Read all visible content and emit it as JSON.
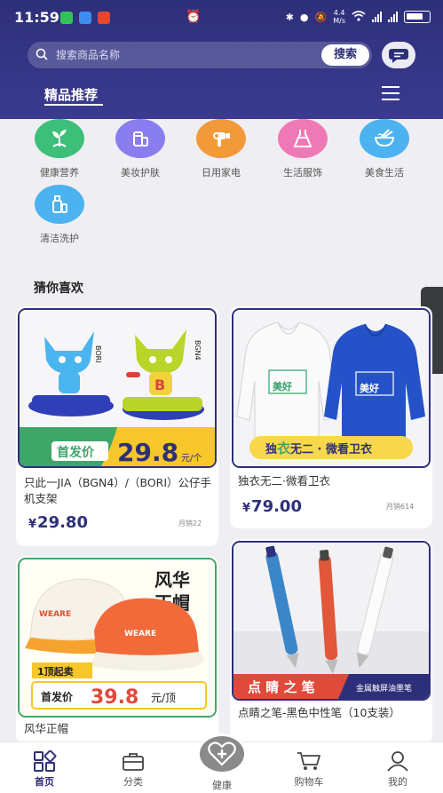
{
  "status_bar": {
    "time": "11:59",
    "network_speed": "4.4",
    "network_unit": "M/s"
  },
  "header": {
    "search_placeholder": "搜索商品名称",
    "search_button": "搜索",
    "tab_title": "精品推荐"
  },
  "categories": [
    {
      "label": "健康营养",
      "color": "#3dbf7a",
      "icon": "sprout-icon"
    },
    {
      "label": "美妆护肤",
      "color": "#8a7df0",
      "icon": "cosmetics-icon"
    },
    {
      "label": "日用家电",
      "color": "#f29a3a",
      "icon": "hair-dryer-icon"
    },
    {
      "label": "生活服饰",
      "color": "#ef79b6",
      "icon": "dress-icon"
    },
    {
      "label": "美食生活",
      "color": "#4cb2f0",
      "icon": "noodle-bowl-icon"
    },
    {
      "label": "清洁洗护",
      "color": "#4cb2f0",
      "icon": "cleaning-bottle-icon"
    }
  ],
  "section_title": "猜你喜欢",
  "products": [
    {
      "title": "只此一JIA（BGN4）/（BORI）公仔手机支架",
      "price_symbol": "¥",
      "price": "29.80",
      "sales": "月销22",
      "banner_left": "首发价",
      "banner_price": "29.8",
      "banner_unit": "元/个",
      "figure_left_label": "BORI",
      "figure_right_label": "BGN4"
    },
    {
      "title": "独衣无二·微看卫衣",
      "price_symbol": "¥",
      "price": "79.00",
      "sales": "月销614",
      "banner_text_1": "独",
      "banner_text_2": "衣",
      "banner_text_3": "无二 · 微看卫衣",
      "hoodie_print": "美好"
    },
    {
      "title": "风华正帽",
      "banner_title_1": "风华",
      "banner_title_2": "正帽",
      "min_order": "1顶起卖",
      "banner_left": "首发价",
      "banner_price": "39.8",
      "banner_unit": "元/顶",
      "cap_brand": "WEARE"
    },
    {
      "title": "点睛之笔-黑色中性笔（10支装）",
      "banner_text": "点 睛 之 笔",
      "banner_sub": "金属触屏油墨笔"
    }
  ],
  "tabbar": [
    {
      "label": "首页",
      "icon": "home-grid-icon",
      "active": true
    },
    {
      "label": "分类",
      "icon": "category-bag-icon",
      "active": false
    },
    {
      "label": "健康",
      "icon": "health-heart-icon",
      "active": false
    },
    {
      "label": "购物车",
      "icon": "cart-icon",
      "active": false
    },
    {
      "label": "我的",
      "icon": "user-icon",
      "active": false
    }
  ],
  "colors": {
    "brand": "#2e2f7a",
    "price_orange": "#f0892a",
    "price_red": "#e04a3a"
  }
}
